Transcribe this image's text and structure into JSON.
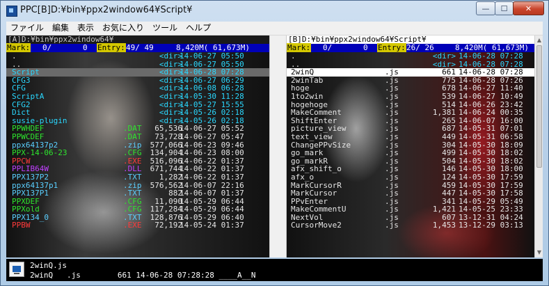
{
  "window": {
    "title": "PPC[B]D:¥bin¥ppx2window64¥Script¥"
  },
  "caption_buttons": {
    "minimize": "—",
    "maximize": "☐",
    "close": "✕"
  },
  "menu": [
    "ファイル",
    "編集",
    "表示",
    "お気に入り",
    "ツール",
    "ヘルプ"
  ],
  "pane_a": {
    "path": "[A]D:¥bin¥ppx2window64¥",
    "mark_label": "Mark:",
    "mark_count": "0/",
    "mark_size": "0",
    "entry_label": "Entry:",
    "entry_value": "49/ 49",
    "disk": "8,420M( 61,673M)",
    "rows": [
      {
        "name": ".",
        "ext": "",
        "size": "<dir>",
        "date": "14-06-27 05:50",
        "color": "c-wht"
      },
      {
        "name": "..",
        "ext": "",
        "size": "<dir>",
        "date": "14-06-27 05:50",
        "color": "c-wht"
      },
      {
        "name": "Script",
        "ext": "",
        "size": "<dir>",
        "date": "14-06-28 07:28",
        "color": "c-dir",
        "cur": true
      },
      {
        "name": "CFG3",
        "ext": "",
        "size": "<dir>",
        "date": "14-06-27 06:29",
        "color": "c-dir"
      },
      {
        "name": "CFG",
        "ext": "",
        "size": "<dir>",
        "date": "14-06-08 06:28",
        "color": "c-dir"
      },
      {
        "name": "ScriptA",
        "ext": "",
        "size": "<dir>",
        "date": "14-05-30 11:28",
        "color": "c-dir"
      },
      {
        "name": "CFG2",
        "ext": "",
        "size": "<dir>",
        "date": "14-05-27 15:55",
        "color": "c-dir"
      },
      {
        "name": "Dict",
        "ext": "",
        "size": "<dir>",
        "date": "14-05-26 02:18",
        "color": "c-dir"
      },
      {
        "name": "susie-plugin",
        "ext": "",
        "size": "<dir>",
        "date": "14-05-26 02:18",
        "color": "c-dir"
      },
      {
        "name": "PPWHDEF",
        "ext": ".DAT",
        "size": "65,536",
        "date": "14-06-27 05:52",
        "color": "c-dat"
      },
      {
        "name": "PPWCDEF",
        "ext": ".DAT",
        "size": "73,728",
        "date": "14-06-27 05:47",
        "color": "c-dat"
      },
      {
        "name": "ppx64137p2",
        "ext": ".zip",
        "size": "577,066",
        "date": "14-06-23 09:46",
        "color": "c-zip"
      },
      {
        "name": "PPX-14-06-23",
        "ext": ".CFG",
        "size": "134,904",
        "date": "14-06-23 08:00",
        "color": "c-cfg"
      },
      {
        "name": "PPCW",
        "ext": ".EXE",
        "size": "516,096",
        "date": "14-06-22 01:37",
        "color": "c-exe"
      },
      {
        "name": "PPLIB64W",
        "ext": ".DLL",
        "size": "671,744",
        "date": "14-06-22 01:37",
        "color": "c-dll"
      },
      {
        "name": "PPX137P2",
        "ext": ".TXT",
        "size": "1,282",
        "date": "14-06-22 01:37",
        "color": "c-txt"
      },
      {
        "name": "ppx64137p1",
        "ext": ".zip",
        "size": "576,562",
        "date": "14-06-07 22:16",
        "color": "c-zip"
      },
      {
        "name": "PPX137P1",
        "ext": ".TXT",
        "size": "882",
        "date": "14-06-07 01:37",
        "color": "c-txt"
      },
      {
        "name": "PPXDEF",
        "ext": ".CFG",
        "size": "11,090",
        "date": "14-05-29 06:44",
        "color": "c-cfg"
      },
      {
        "name": "PPXold",
        "ext": ".CFG",
        "size": "117,284",
        "date": "14-05-29 06:44",
        "color": "c-cfg"
      },
      {
        "name": "PPX134_0",
        "ext": ".TXT",
        "size": "128,876",
        "date": "14-05-29 06:40",
        "color": "c-txt"
      },
      {
        "name": "PPBW",
        "ext": ".EXE",
        "size": "72,192",
        "date": "14-05-24 01:37",
        "color": "c-exe"
      }
    ]
  },
  "pane_b": {
    "path": "[B]D:¥bin¥ppx2window64¥Script¥",
    "mark_label": "Mark:",
    "mark_count": "0/",
    "mark_size": "0",
    "entry_label": "Entry:",
    "entry_value": "26/ 26",
    "disk": "8,420M( 61,673M)",
    "rows": [
      {
        "name": ".",
        "ext": "",
        "size": "<dir>",
        "date": "14-06-28 07:28",
        "color": "c-wht"
      },
      {
        "name": "..",
        "ext": "",
        "size": "<dir>",
        "date": "14-06-28 07:28",
        "color": "c-wht"
      },
      {
        "name": "2winQ",
        "ext": ".js",
        "size": "661",
        "date": "14-06-28 07:28",
        "color": "c-wht",
        "sel": true
      },
      {
        "name": "2winTab",
        "ext": ".js",
        "size": "775",
        "date": "14-06-28 07:26",
        "color": "c-wht"
      },
      {
        "name": "hoge",
        "ext": ".js",
        "size": "678",
        "date": "14-06-27 11:40",
        "color": "c-wht"
      },
      {
        "name": "1to2win",
        "ext": ".js",
        "size": "539",
        "date": "14-06-27 10:49",
        "color": "c-wht"
      },
      {
        "name": "hogehoge",
        "ext": ".js",
        "size": "514",
        "date": "14-06-26 23:42",
        "color": "c-wht"
      },
      {
        "name": "MakeComment",
        "ext": ".js",
        "size": "1,381",
        "date": "14-06-24 00:35",
        "color": "c-wht"
      },
      {
        "name": "ShiftEnter",
        "ext": ".js",
        "size": "265",
        "date": "14-06-07 16:00",
        "color": "c-wht"
      },
      {
        "name": "picture_view",
        "ext": ".js",
        "size": "687",
        "date": "14-05-31 07:01",
        "color": "c-wht"
      },
      {
        "name": "text_view",
        "ext": ".js",
        "size": "449",
        "date": "14-05-31 06:58",
        "color": "c-wht"
      },
      {
        "name": "ChangePPvSize",
        "ext": ".js",
        "size": "304",
        "date": "14-05-30 18:09",
        "color": "c-wht"
      },
      {
        "name": "go_mark",
        "ext": ".js",
        "size": "499",
        "date": "14-05-30 18:02",
        "color": "c-wht"
      },
      {
        "name": "go_markR",
        "ext": ".js",
        "size": "504",
        "date": "14-05-30 18:02",
        "color": "c-wht"
      },
      {
        "name": "afx_shift_o",
        "ext": ".js",
        "size": "146",
        "date": "14-05-30 18:00",
        "color": "c-wht"
      },
      {
        "name": "afx_o",
        "ext": ".js",
        "size": "124",
        "date": "14-05-30 17:59",
        "color": "c-wht"
      },
      {
        "name": "MarkCursorR",
        "ext": ".js",
        "size": "459",
        "date": "14-05-30 17:59",
        "color": "c-wht"
      },
      {
        "name": "MarkCursor",
        "ext": ".js",
        "size": "447",
        "date": "14-05-30 17:58",
        "color": "c-wht"
      },
      {
        "name": "PPvEnter",
        "ext": ".js",
        "size": "341",
        "date": "14-05-29 05:49",
        "color": "c-wht"
      },
      {
        "name": "MakeCommentU",
        "ext": ".js",
        "size": "1,421",
        "date": "14-05-25 23:33",
        "color": "c-wht"
      },
      {
        "name": "NextVol",
        "ext": ".js",
        "size": "607",
        "date": "13-12-31 04:24",
        "color": "c-wht"
      },
      {
        "name": "CursorMove2",
        "ext": ".js",
        "size": "1,453",
        "date": "13-12-29 03:13",
        "color": "c-wht"
      }
    ]
  },
  "status": {
    "line1": "2winQ.js",
    "line2": "2winQ   .js        661 14-06-28 07:28:28 ____A__N"
  }
}
